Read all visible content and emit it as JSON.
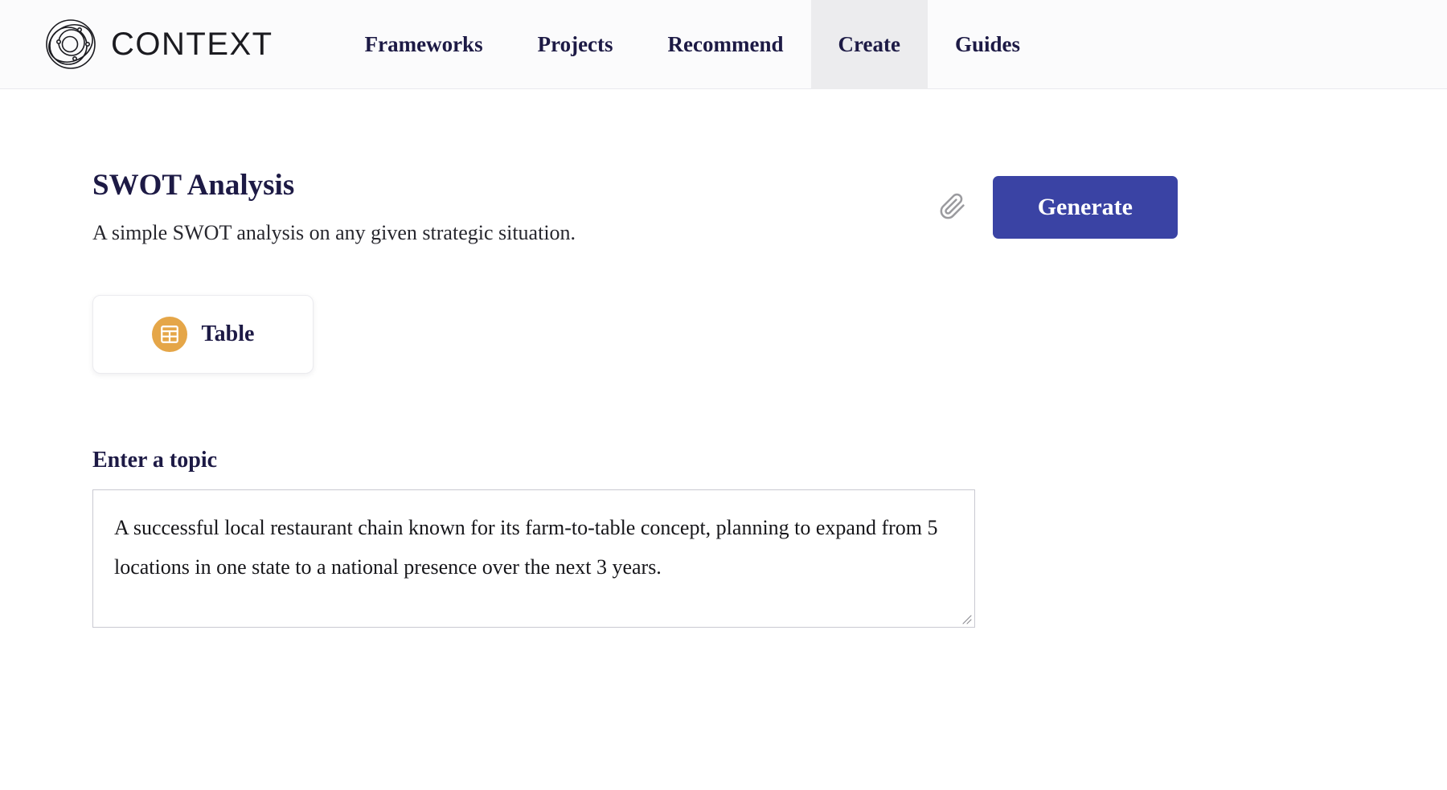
{
  "brand": {
    "name": "CONTEXT",
    "logo_icon": "orbital-circles-logo"
  },
  "nav": {
    "items": [
      {
        "label": "Frameworks",
        "active": false
      },
      {
        "label": "Projects",
        "active": false
      },
      {
        "label": "Recommend",
        "active": false
      },
      {
        "label": "Create",
        "active": true
      },
      {
        "label": "Guides",
        "active": false
      }
    ]
  },
  "page": {
    "title": "SWOT Analysis",
    "subtitle": "A simple SWOT analysis on any given strategic situation."
  },
  "actions": {
    "attach_icon": "paperclip-icon",
    "generate_label": "Generate"
  },
  "format": {
    "label": "Table",
    "icon": "table-grid-icon"
  },
  "topic": {
    "label": "Enter a topic",
    "value": "A successful local restaurant chain known for its farm-to-table concept, planning to expand from 5 locations in one state to a national presence over the next 3 years.",
    "placeholder": "Enter a topic"
  },
  "colors": {
    "accent_blue": "#3a43a4",
    "navy_text": "#1d1a45",
    "amber_icon": "#e5a648",
    "header_bg": "#fbfbfc",
    "active_tab_bg": "#ececee"
  }
}
